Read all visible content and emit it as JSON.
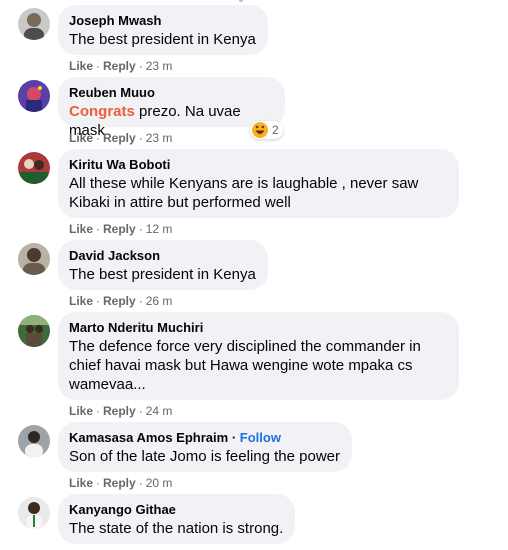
{
  "actions": {
    "like": "Like",
    "reply": "Reply",
    "separator": "·"
  },
  "comments": [
    {
      "author": "Joseph Mwash",
      "text": "The best president in Kenya",
      "time": "23 m"
    },
    {
      "author": "Reuben Muuo",
      "highlight": "Congrats",
      "text": " prezo. Na uvae mask",
      "time": "23 m",
      "reaction": {
        "icon": "laughing-emoji-icon",
        "count": "2"
      }
    },
    {
      "author": "Kiritu Wa Boboti",
      "text_lines": [
        "All these while Kenyans are is laughable , never saw",
        "Kibaki in attire but performed well"
      ],
      "time": "12 m"
    },
    {
      "author": "David Jackson",
      "text": "The best president in Kenya",
      "time": "26 m"
    },
    {
      "author": "Marto Nderitu Muchiri",
      "text_lines": [
        "The defence force very disciplined the commander in",
        "chief havai mask but Hawa wengine wote mpaka cs",
        "wamevaa..."
      ],
      "time": "24 m"
    },
    {
      "author": "Kamasasa Amos Ephraim",
      "follow": "Follow",
      "text": "Son of the late Jomo is feeling the power",
      "time": "20 m"
    },
    {
      "author": "Kanyango Githae",
      "text": "The state of the nation is strong."
    }
  ],
  "colors": {
    "bubble": "#f0f2f5",
    "meta": "#65676b",
    "follow": "#216fdb",
    "highlight": "#f05d3b"
  }
}
